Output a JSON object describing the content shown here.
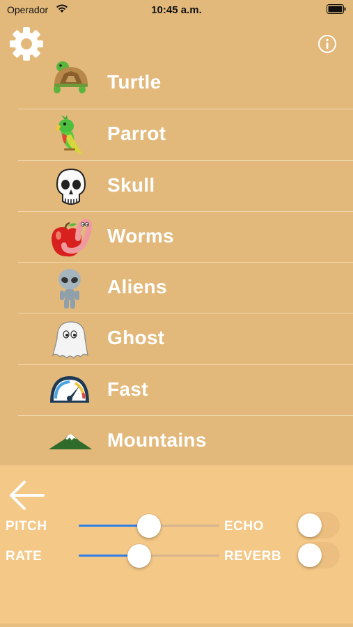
{
  "status_bar": {
    "carrier": "Operador",
    "time": "10:45 a.m."
  },
  "header": {
    "settings_icon": "gear-icon",
    "info_icon": "info-icon"
  },
  "list": {
    "items": [
      {
        "label": "Turtle",
        "icon": "turtle-icon"
      },
      {
        "label": "Parrot",
        "icon": "parrot-icon"
      },
      {
        "label": "Skull",
        "icon": "skull-icon"
      },
      {
        "label": "Worms",
        "icon": "worm-apple-icon"
      },
      {
        "label": "Aliens",
        "icon": "alien-icon"
      },
      {
        "label": "Ghost",
        "icon": "ghost-icon"
      },
      {
        "label": "Fast",
        "icon": "speedometer-icon"
      },
      {
        "label": "Mountains",
        "icon": "mountain-icon"
      }
    ]
  },
  "controls": {
    "back_icon": "arrow-left-icon",
    "pitch_label": "PITCH",
    "rate_label": "RATE",
    "echo_label": "ECHO",
    "reverb_label": "REVERB",
    "pitch_value": 0.5,
    "rate_value": 0.43,
    "echo_on": false,
    "reverb_on": false,
    "accent_color": "#2f7fe6"
  },
  "colors": {
    "background": "#e2b97b",
    "panel": "#f4c887"
  }
}
